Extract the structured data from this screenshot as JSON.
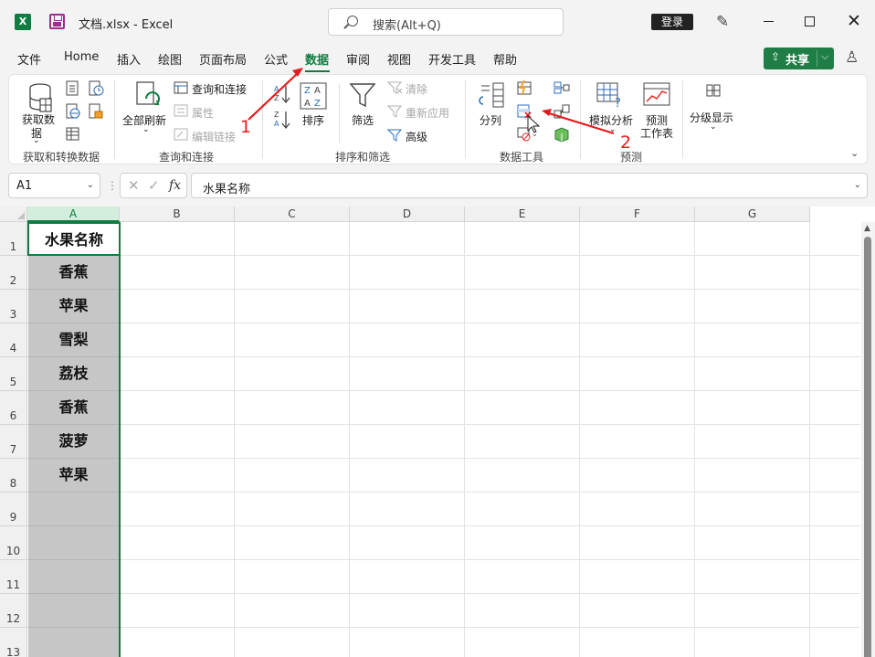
{
  "titlebar": {
    "app_logo": "X",
    "doc_title": "文档.xlsx  -  Excel",
    "search_placeholder": "搜索(Alt+Q)",
    "login_label": "登录"
  },
  "tabs": [
    "文件",
    "Home",
    "插入",
    "绘图",
    "页面布局",
    "公式",
    "数据",
    "审阅",
    "视图",
    "开发工具",
    "帮助"
  ],
  "active_tab": "数据",
  "share_label": "共享",
  "ribbon": {
    "get_data": {
      "label1": "获取数",
      "label2": "据",
      "group": "获取和转换数据"
    },
    "queries": {
      "refresh_all": "全部刷新",
      "queries_connections": "查询和连接",
      "properties": "属性",
      "edit_links": "编辑链接",
      "group": "查询和连接"
    },
    "sort_filter": {
      "sort": "排序",
      "filter": "筛选",
      "clear": "清除",
      "reapply": "重新应用",
      "advanced": "高级",
      "group": "排序和筛选"
    },
    "data_tools": {
      "text_to_columns": "分列",
      "group": "数据工具"
    },
    "forecast": {
      "what_if": "模拟分析",
      "forecast_sheet1": "预测",
      "forecast_sheet2": "工作表",
      "group": "预测"
    },
    "outline": {
      "label": "分级显示"
    }
  },
  "formula_bar": {
    "name_box": "A1",
    "fx": "fx",
    "value": "水果名称"
  },
  "grid": {
    "columns": [
      "A",
      "B",
      "C",
      "D",
      "E",
      "F",
      "G"
    ],
    "rows": [
      "1",
      "2",
      "3",
      "4",
      "5",
      "6",
      "7",
      "8",
      "9",
      "10",
      "11",
      "12",
      "13"
    ],
    "cells_A": [
      "水果名称",
      "香蕉",
      "苹果",
      "雪梨",
      "荔枝",
      "香蕉",
      "菠萝",
      "苹果"
    ]
  },
  "annotations": [
    "1",
    "2"
  ],
  "colors": {
    "accent": "#107c41",
    "annotation": "#e51b1b",
    "selection": "#c6c6c6"
  }
}
